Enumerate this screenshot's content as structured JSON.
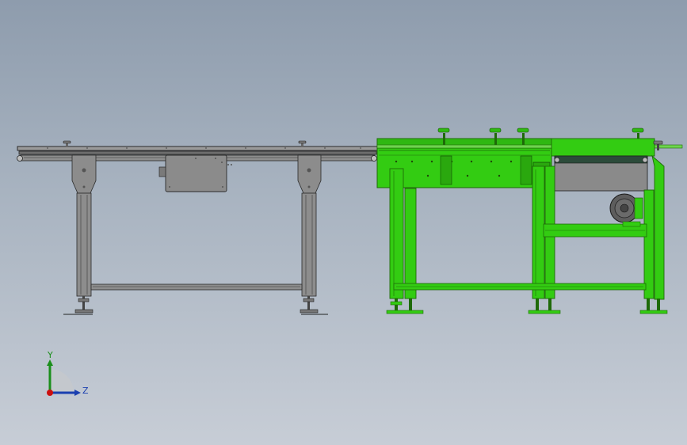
{
  "viewport": {
    "background_top": "#8e9cad",
    "background_bottom": "#c7cdd6"
  },
  "colors": {
    "gray_part": "#8a8a8a",
    "gray_dark": "#3c3c3c",
    "green_part": "#33cc12",
    "green_dark": "#1e7a08",
    "motor": "#5a5a5a"
  },
  "triad": {
    "y_label": "Y",
    "z_label": "Z",
    "y_color": "#1b8f1b",
    "z_color": "#1a3fb0",
    "x_color": "#cc1010"
  }
}
